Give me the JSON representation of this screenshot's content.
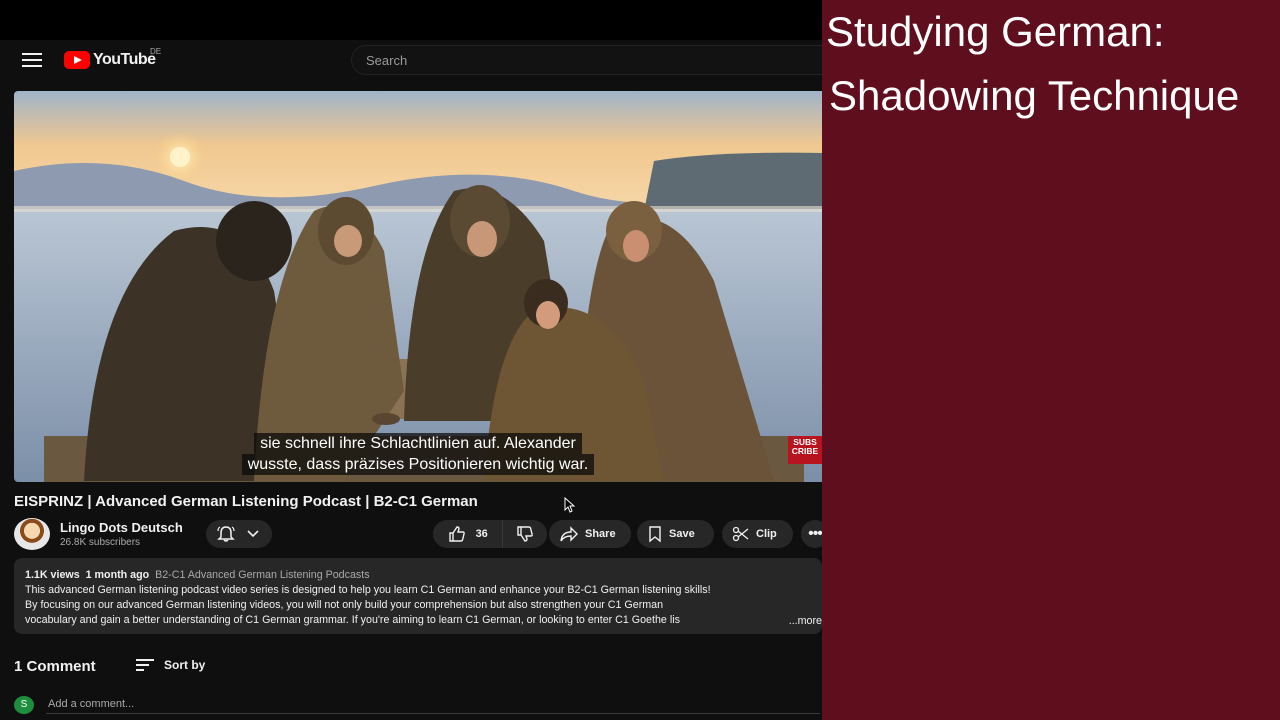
{
  "masthead": {
    "logo_text": "YouTube",
    "country_code": "DE",
    "search_placeholder": "Search"
  },
  "player": {
    "caption_line1": "sie schnell ihre Schlachtlinien auf. Alexander",
    "caption_line2": "wusste, dass präzises Positionieren wichtig war.",
    "subscribe_badge": "SUBS CRIBE"
  },
  "video": {
    "title": "EISPRINZ | Advanced German Listening Podcast | B2-C1 German"
  },
  "channel": {
    "name": "Lingo Dots Deutsch",
    "subscribers": "26.8K subscribers"
  },
  "actions": {
    "like_count": "36",
    "share_label": "Share",
    "save_label": "Save",
    "clip_label": "Clip",
    "more_label": "•••"
  },
  "description": {
    "views": "1.1K views",
    "age": "1 month ago",
    "playlist": "B2-C1 Advanced German Listening Podcasts",
    "line1": "This advanced German listening podcast video series is designed to help you learn C1 German and enhance your B2-C1 German listening skills!",
    "line2": "By focusing on our advanced German listening videos, you will not only build your comprehension but also strengthen your C1 German",
    "line3": "vocabulary and gain a better understanding of C1 German grammar. If you're aiming to learn C1 German, or looking to enter C1 Goethe lis",
    "more": "...more"
  },
  "comments": {
    "heading": "1 Comment",
    "sort_label": "Sort by",
    "user_initial": "S",
    "add_placeholder": "Add a comment..."
  },
  "overlay": {
    "title_line1": "Studying German:",
    "title_line2": "Shadowing Technique"
  },
  "colors": {
    "background": "#0f0f0f",
    "brand_red": "#ff0000",
    "side_panel": "#5e0e1c",
    "pill": "#272727"
  }
}
